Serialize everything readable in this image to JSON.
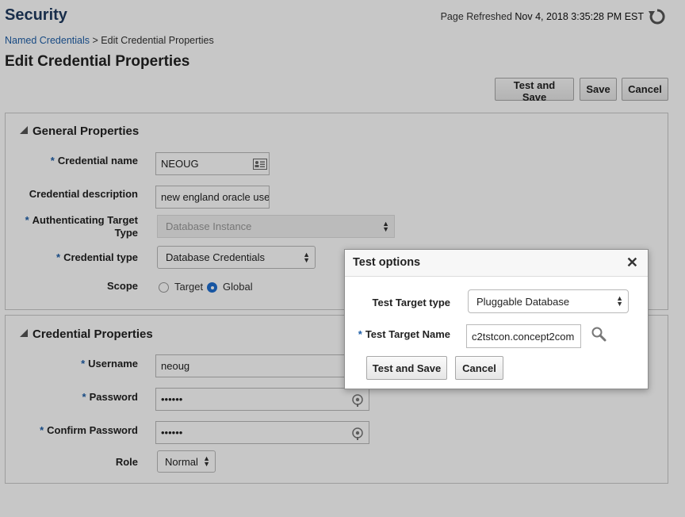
{
  "header": {
    "title": "Security",
    "refreshed_label": "Page Refreshed",
    "refreshed_time": "Nov 4, 2018 3:35:28 PM EST"
  },
  "breadcrumb": {
    "link": "Named Credentials",
    "separator": ">",
    "current": "Edit Credential Properties"
  },
  "page_title": "Edit Credential Properties",
  "toolbar": {
    "test_and_save": "Test and Save",
    "save": "Save",
    "cancel": "Cancel"
  },
  "general": {
    "title": "General Properties",
    "credential_name_label": "Credential name",
    "credential_name_value": "NEOUG",
    "description_label": "Credential description",
    "description_value": "new england oracle user",
    "auth_target_label_1": "Authenticating Target",
    "auth_target_label_2": "Type",
    "auth_target_value": "Database Instance",
    "credential_type_label": "Credential type",
    "credential_type_value": "Database Credentials",
    "scope_label": "Scope",
    "scope_target": "Target",
    "scope_global": "Global",
    "required_mark": "*"
  },
  "credential": {
    "title": "Credential Properties",
    "username_label": "Username",
    "username_value": "neoug",
    "password_label": "Password",
    "password_value": "••••••",
    "confirm_label": "Confirm Password",
    "confirm_value": "••••••",
    "role_label": "Role",
    "role_value": "Normal"
  },
  "dialog": {
    "title": "Test options",
    "close": "✕",
    "target_type_label": "Test Target type",
    "target_type_value": "Pluggable Database",
    "target_name_label": "Test Target Name",
    "target_name_value": "c2tstcon.concept2com",
    "test_and_save": "Test and Save",
    "cancel": "Cancel"
  },
  "colors": {
    "accent": "#1f5fa8",
    "title": "#1f3a5f"
  }
}
